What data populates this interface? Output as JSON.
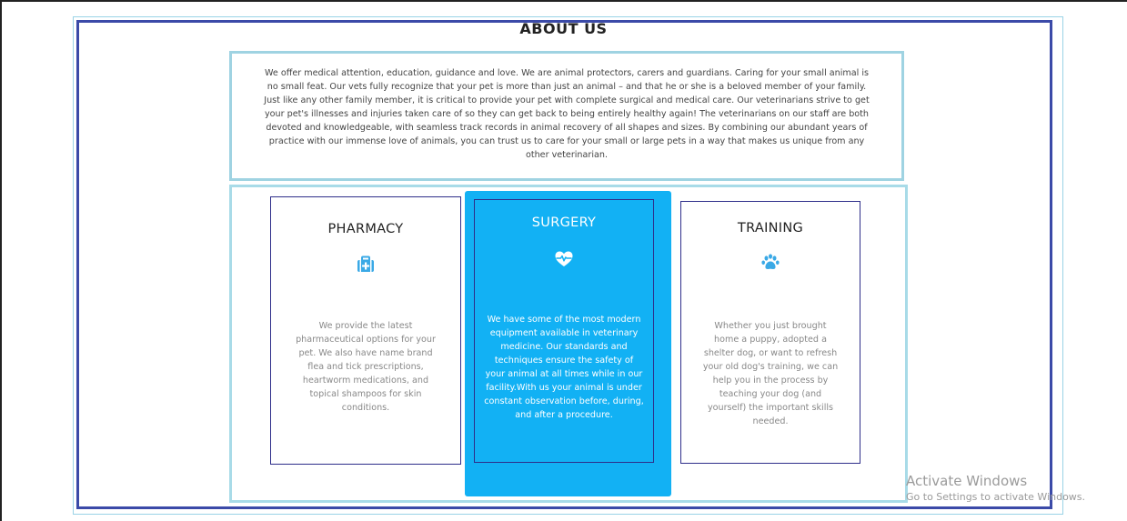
{
  "about": {
    "title": "ABOUT US",
    "body": "We offer medical attention, education, guidance and love. We are animal protectors, carers and guardians. Caring for your small animal is no small feat. Our vets fully recognize that your pet is more than just an animal – and that he or she is a beloved member of your family. Just like any other family member, it is critical to provide your pet with complete surgical and medical care. Our veterinarians strive to get your pet's illnesses and injuries taken care of so they can get back to being entirely healthy again! The veterinarians on our staff are both devoted and knowledgeable, with seamless track records in animal recovery of all shapes and sizes. By combining our abundant years of practice with our immense love of animals, you can trust us to care for your small or large pets in a way that makes us unique from any other veterinarian."
  },
  "services": [
    {
      "title": "PHARMACY",
      "icon": "medical-kit-icon",
      "text": "We provide the latest pharmaceutical options for your pet. We also have name brand flea and tick prescriptions, heartworm medications, and topical shampoos for skin conditions."
    },
    {
      "title": "SURGERY",
      "icon": "heart-pulse-icon",
      "text": "We have some of the most modern equipment available in veterinary medicine. Our standards and techniques ensure the safety of your animal at all times while in our facility.With us your animal is under constant observation before, during, and after a procedure."
    },
    {
      "title": "TRAINING",
      "icon": "paw-icon",
      "text": "Whether you just brought home a puppy, adopted a shelter dog, or want to refresh your old dog's training, we can help you in the process by teaching your dog (and yourself) the important skills needed."
    }
  ],
  "watermark": {
    "title": "Activate Windows",
    "subtitle": "Go to Settings to activate Windows."
  },
  "colors": {
    "accent": "#12b1f4",
    "icon": "#3aa9e6",
    "frame": "#3b4aa8",
    "border_light": "#9fd3e2"
  }
}
